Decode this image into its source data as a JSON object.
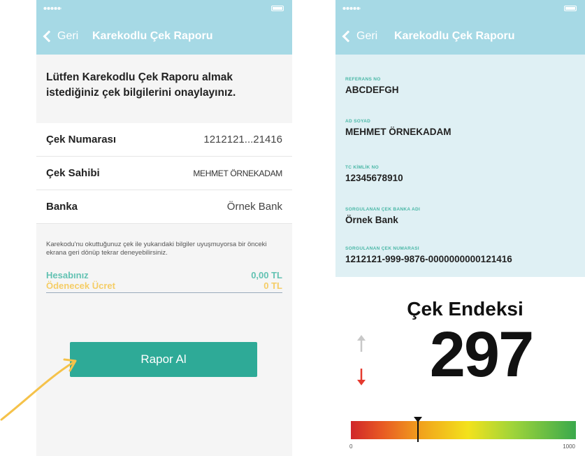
{
  "status_bar": {
    "time": "",
    "battery": ""
  },
  "left_screen": {
    "nav": {
      "back_label": "Geri",
      "title": "Karekodlu Çek Raporu"
    },
    "intro_text": "Lütfen Karekodlu Çek Raporu almak istediğiniz çek bilgilerini onaylayınız.",
    "rows": [
      {
        "label": "Çek Numarası",
        "value": "1212121...21416"
      },
      {
        "label": "Çek Sahibi",
        "value": "MEHMET ÖRNEKADAM"
      },
      {
        "label": "Banka",
        "value": "Örnek Bank"
      }
    ],
    "note": "Karekodu'nu okuttuğunuz çek ile yukarıdaki bilgiler uyuşmuyorsa bir önceki ekrana geri dönüp tekrar deneyebilirsiniz.",
    "balance": {
      "label": "Hesabınız",
      "value": "0,00 TL"
    },
    "fee": {
      "label": "Ödenecek Ücret",
      "value": "0 TL"
    },
    "cta_label": "Rapor Al"
  },
  "right_screen": {
    "nav": {
      "back_label": "Geri",
      "title": "Karekodlu Çek Raporu"
    },
    "fields": [
      {
        "label": "REFERANS NO",
        "value": "ABCDEFGH"
      },
      {
        "label": "AD SOYAD",
        "value": "MEHMET ÖRNEKADAM"
      },
      {
        "label": "TC KİMLİK NO",
        "value": "12345678910"
      },
      {
        "label": "SORGULANAN ÇEK BANKA ADI",
        "value": "Örnek Bank"
      },
      {
        "label": "SORGULANAN ÇEK NUMARASI",
        "value": "1212121-999-9876-0000000000121416"
      }
    ],
    "index_title": "Çek Endeksi",
    "index_value": "297",
    "gauge": {
      "min_label": "0",
      "max_label": "1000",
      "value": 297,
      "min": 0,
      "max": 1000
    }
  },
  "colors": {
    "nav_bar": "#a6d9e5",
    "primary_button": "#2eaa97",
    "balance_text": "#63c2b3",
    "fee_text": "#f5cd66",
    "trend_down": "#e53a2f",
    "trend_up": "#c8c8c8"
  },
  "icons": {
    "back": "chevron-left-icon",
    "trend_up": "arrow-up-icon",
    "trend_down": "arrow-down-icon",
    "hint": "curved-arrow-icon"
  }
}
